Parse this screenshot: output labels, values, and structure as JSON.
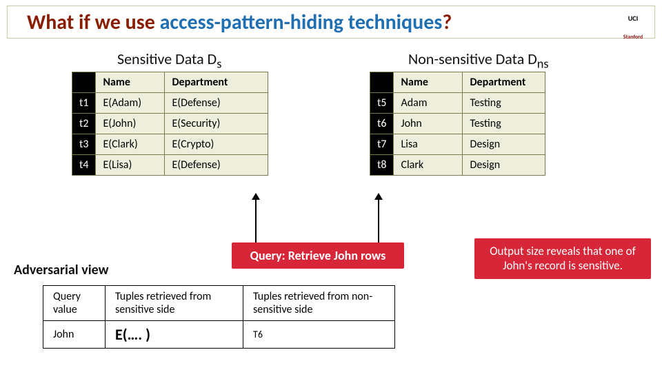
{
  "title": {
    "prefix": "What if we use ",
    "accent": "access-pattern-hiding techniques",
    "suffix": "?"
  },
  "logos": {
    "top": "UCI",
    "bottom": "Stanford"
  },
  "labels": {
    "sensitive": "Sensitive Data D",
    "sensitive_sub": "s",
    "nonsensitive": "Non-sensitive Data D",
    "nonsensitive_sub": "ns",
    "adversarial": "Adversarial view"
  },
  "headers": {
    "name": "Name",
    "department": "Department"
  },
  "sensitive_rows": [
    {
      "id": "t1",
      "name": "E(Adam)",
      "dept": "E(Defense)"
    },
    {
      "id": "t2",
      "name": "E(John)",
      "dept": "E(Security)"
    },
    {
      "id": "t3",
      "name": "E(Clark)",
      "dept": "E(Crypto)"
    },
    {
      "id": "t4",
      "name": "E(Lisa)",
      "dept": "E(Defense)"
    }
  ],
  "nonsensitive_rows": [
    {
      "id": "t5",
      "name": "Adam",
      "dept": "Testing"
    },
    {
      "id": "t6",
      "name": "John",
      "dept": "Testing"
    },
    {
      "id": "t7",
      "name": "Lisa",
      "dept": "Design"
    },
    {
      "id": "t8",
      "name": "Clark",
      "dept": "Design"
    }
  ],
  "query_text": "Query: Retrieve John rows",
  "reveal_text": "Output size reveals that one of John's record is sensitive.",
  "bottom": {
    "h1": "Query value",
    "h2": "Tuples retrieved from sensitive side",
    "h3": "Tuples retrieved from non-sensitive side",
    "r1c1": "John",
    "r1c2": "E(…. )",
    "r1c3": "T6"
  }
}
